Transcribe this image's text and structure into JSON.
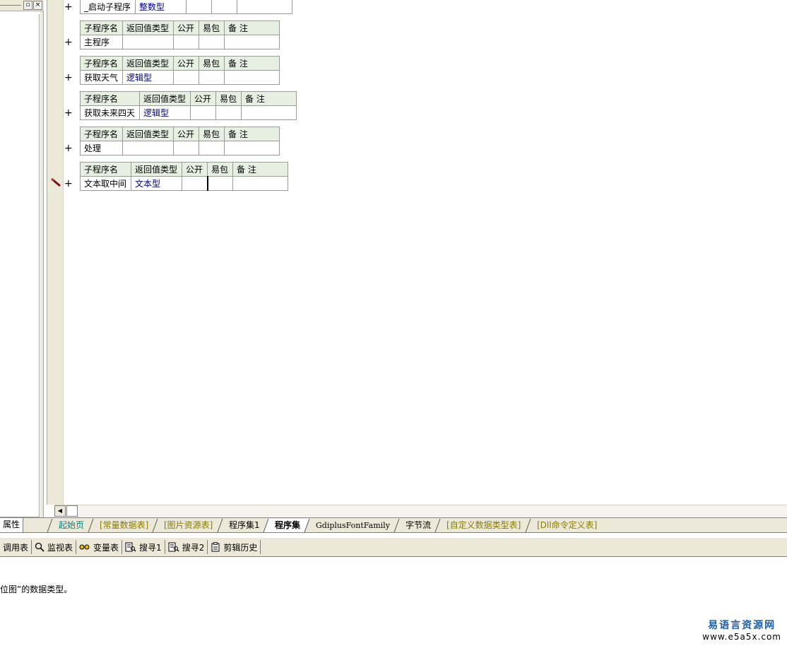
{
  "editor": {
    "subprograms": [
      {
        "header": [
          "子程序名",
          "返回值类型",
          "公开",
          "易包",
          "备 注"
        ],
        "name": "_启动子程序",
        "return_type": "整数型"
      },
      {
        "header": [
          "子程序名",
          "返回值类型",
          "公开",
          "易包",
          "备 注"
        ],
        "name": "主程序",
        "return_type": ""
      },
      {
        "header": [
          "子程序名",
          "返回值类型",
          "公开",
          "易包",
          "备 注"
        ],
        "name": "获取天气",
        "return_type": "逻辑型"
      },
      {
        "header": [
          "子程序名",
          "返回值类型",
          "公开",
          "易包",
          "备 注"
        ],
        "name": "获取未来四天",
        "return_type": "逻辑型"
      },
      {
        "header": [
          "子程序名",
          "返回值类型",
          "公开",
          "易包",
          "备 注"
        ],
        "name": "处理",
        "return_type": ""
      },
      {
        "header": [
          "子程序名",
          "返回值类型",
          "公开",
          "易包",
          "备 注"
        ],
        "name": "文本取中间",
        "return_type": "文本型"
      }
    ],
    "expand_symbol": "+"
  },
  "left_panel": {
    "tab_label": "属性"
  },
  "tabs": [
    {
      "label": "起始页",
      "style": "cyan"
    },
    {
      "label": "[常量数据表]",
      "style": "olive"
    },
    {
      "label": "[图片资源表]",
      "style": "olive"
    },
    {
      "label": "程序集1",
      "style": "normal"
    },
    {
      "label": "程序集",
      "style": "bold"
    },
    {
      "label": "GdiplusFontFamily",
      "style": "mono"
    },
    {
      "label": "字节流",
      "style": "normal"
    },
    {
      "label": "[自定义数据类型表]",
      "style": "olive"
    },
    {
      "label": "[Dll命令定义表]",
      "style": "olive"
    }
  ],
  "toolbar": [
    {
      "label": "调用表",
      "icon": "none"
    },
    {
      "label": "监视表",
      "icon": "magnifier-icon"
    },
    {
      "label": "变量表",
      "icon": "variables-icon"
    },
    {
      "label": "搜寻1",
      "icon": "search-doc-icon"
    },
    {
      "label": "搜寻2",
      "icon": "search-doc-icon"
    },
    {
      "label": "剪辑历史",
      "icon": "clipboard-icon"
    }
  ],
  "output": {
    "message": "位图”的数据类型。"
  },
  "watermark": {
    "cn": "易语言资源网",
    "url": "www.e5a5x.com"
  }
}
